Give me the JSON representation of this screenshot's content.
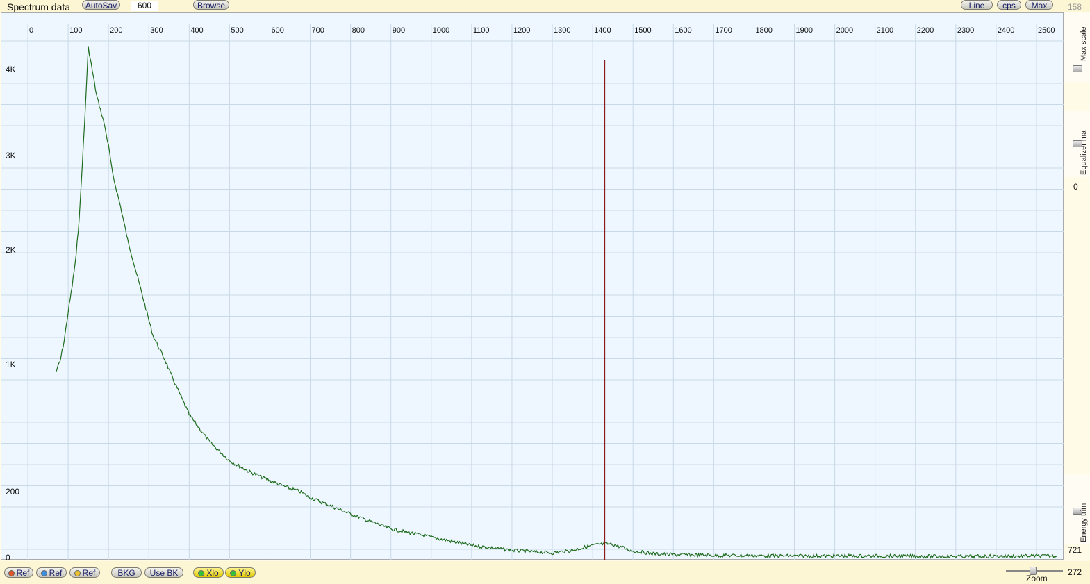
{
  "toolbar": {
    "title": "Spectrum data",
    "autosave_label": "AutoSav",
    "autosave_value": "600",
    "browse_label": "Browse",
    "line_label": "Line",
    "cps_label": "cps",
    "max_label": "Max",
    "max_scale_value": "158"
  },
  "side": {
    "max_scale_label": "Max scale",
    "equalizer_label": "Equalizer ma",
    "equalizer_value": "0",
    "energy_trim_label": "Energy trim",
    "energy_trim_value": "721"
  },
  "bottom": {
    "ref1_label": "Ref",
    "ref2_label": "Ref",
    "ref3_label": "Ref",
    "bkg_label": "BKG",
    "usebk_label": "Use BK",
    "xlo_label": "Xlo",
    "ylo_label": "Ylo",
    "zoom_label": "Zoom",
    "zoom_value": "272"
  },
  "colors": {
    "series": "#1e6b1e",
    "marker": "#8b1a1a",
    "grid": "#c9d8e6",
    "ref1": "#e0552a",
    "ref2": "#3a8fe0",
    "ref3": "#e8c030",
    "xlo_led": "#35c23a",
    "ylo_led": "#35c23a"
  },
  "chart_data": {
    "type": "line",
    "x_ticks": [
      "0",
      "100",
      "200",
      "300",
      "400",
      "500",
      "600",
      "700",
      "800",
      "900",
      "1000",
      "1100",
      "1200",
      "1300",
      "1400",
      "1500",
      "1600",
      "1700",
      "1800",
      "1900",
      "2000",
      "2100",
      "2200",
      "2300",
      "2400",
      "2500"
    ],
    "y_ticks": [
      "0",
      "200",
      "1K",
      "2K",
      "3K",
      "4K"
    ],
    "series": [
      {
        "x": [
          70,
          80,
          90,
          100,
          110,
          120,
          125,
          130,
          140,
          150,
          170,
          190,
          200,
          210,
          230,
          250,
          280,
          310,
          350,
          400,
          450,
          500,
          550,
          600,
          650,
          700,
          800,
          900,
          1000,
          1100,
          1200,
          1300,
          1350,
          1400,
          1430,
          1450,
          1470,
          1500,
          1550,
          1600,
          1700,
          1800,
          1900,
          2000,
          2100,
          2200,
          2300,
          2400,
          2500,
          2550
        ],
        "y": [
          950,
          1020,
          1200,
          1450,
          1680,
          1950,
          2200,
          2500,
          3300,
          4250,
          3700,
          3350,
          3100,
          2800,
          2450,
          2050,
          1650,
          1250,
          960,
          680,
          510,
          390,
          320,
          265,
          215,
          180,
          130,
          85,
          60,
          35,
          20,
          12,
          20,
          35,
          40,
          38,
          30,
          18,
          10,
          7,
          5,
          4,
          3,
          3,
          3,
          2,
          2,
          2,
          3,
          3
        ]
      }
    ],
    "marker_x": 1430
  }
}
